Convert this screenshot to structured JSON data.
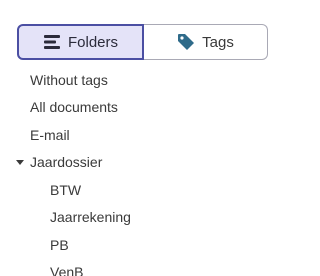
{
  "view_toggle": {
    "folders_label": "Folders",
    "tags_label": "Tags",
    "active": "folders",
    "icons": {
      "folders": "list-lines-icon",
      "tags": "tag-icon"
    }
  },
  "colors": {
    "active_bg": "#e4e3f8",
    "active_border": "#4b4fa3",
    "inactive_border": "#a9a9b5",
    "tag_icon": "#2f6b8a"
  },
  "tree": {
    "without_tags": "Without tags",
    "all_documents": "All documents",
    "email": "E-mail",
    "jaardossier": {
      "label": "Jaardossier",
      "expanded": true,
      "children": [
        "BTW",
        "Jaarrekening",
        "PB",
        "VenB"
      ]
    }
  }
}
